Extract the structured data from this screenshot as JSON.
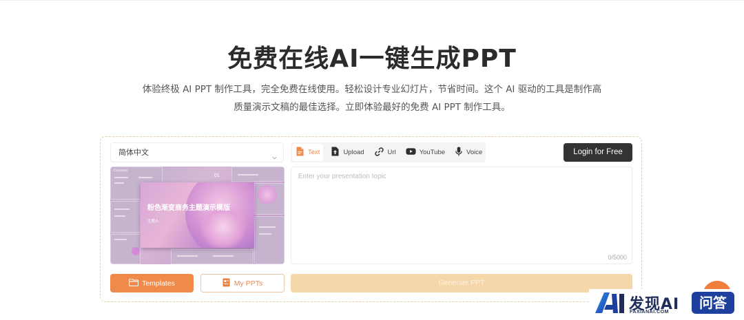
{
  "hero": {
    "title": "免费在线AI一键生成PPT",
    "description_line1": "体验终极 AI PPT 制作工具，完全免费在线使用。轻松设计专业幻灯片，节省时间。这个 AI 驱动的工具是制作高",
    "description_line2": "质量演示文稿的最佳选择。立即体验最好的免费 AI PPT 制作工具。"
  },
  "language_select": {
    "value": "简体中文",
    "icon": "chevron-down-icon"
  },
  "input_tabs": [
    {
      "label": "Text",
      "icon": "text-file-icon",
      "active": true
    },
    {
      "label": "Upload",
      "icon": "upload-icon",
      "active": false
    },
    {
      "label": "Url",
      "icon": "link-icon",
      "active": false
    },
    {
      "label": "YouTube",
      "icon": "youtube-icon",
      "active": false
    },
    {
      "label": "Voice",
      "icon": "microphone-icon",
      "active": false
    }
  ],
  "login_button": {
    "label": "Login for Free"
  },
  "template_preview": {
    "slide_title": "粉色渐变商务主题演示模版",
    "slide_author": "主题人",
    "thumb_label_contents": "Contents",
    "thumb_label_01": "01"
  },
  "topic_input": {
    "placeholder": "Enter your presentation topic",
    "counter": "0/5000"
  },
  "actions": {
    "templates_label": "Templates",
    "my_ppts_label": "My PPTs",
    "generate_label": "Generate PPT"
  },
  "watermark": {
    "brand": "发现AI",
    "sub": "FAXIANAI.COM",
    "badge": "问答"
  },
  "colors": {
    "accent_orange": "#f08a4b",
    "generate_disabled": "#f6d7a9",
    "login_dark": "#333333",
    "panel_border": "#e4cfa4",
    "watermark_blue": "#1d3f9e"
  }
}
